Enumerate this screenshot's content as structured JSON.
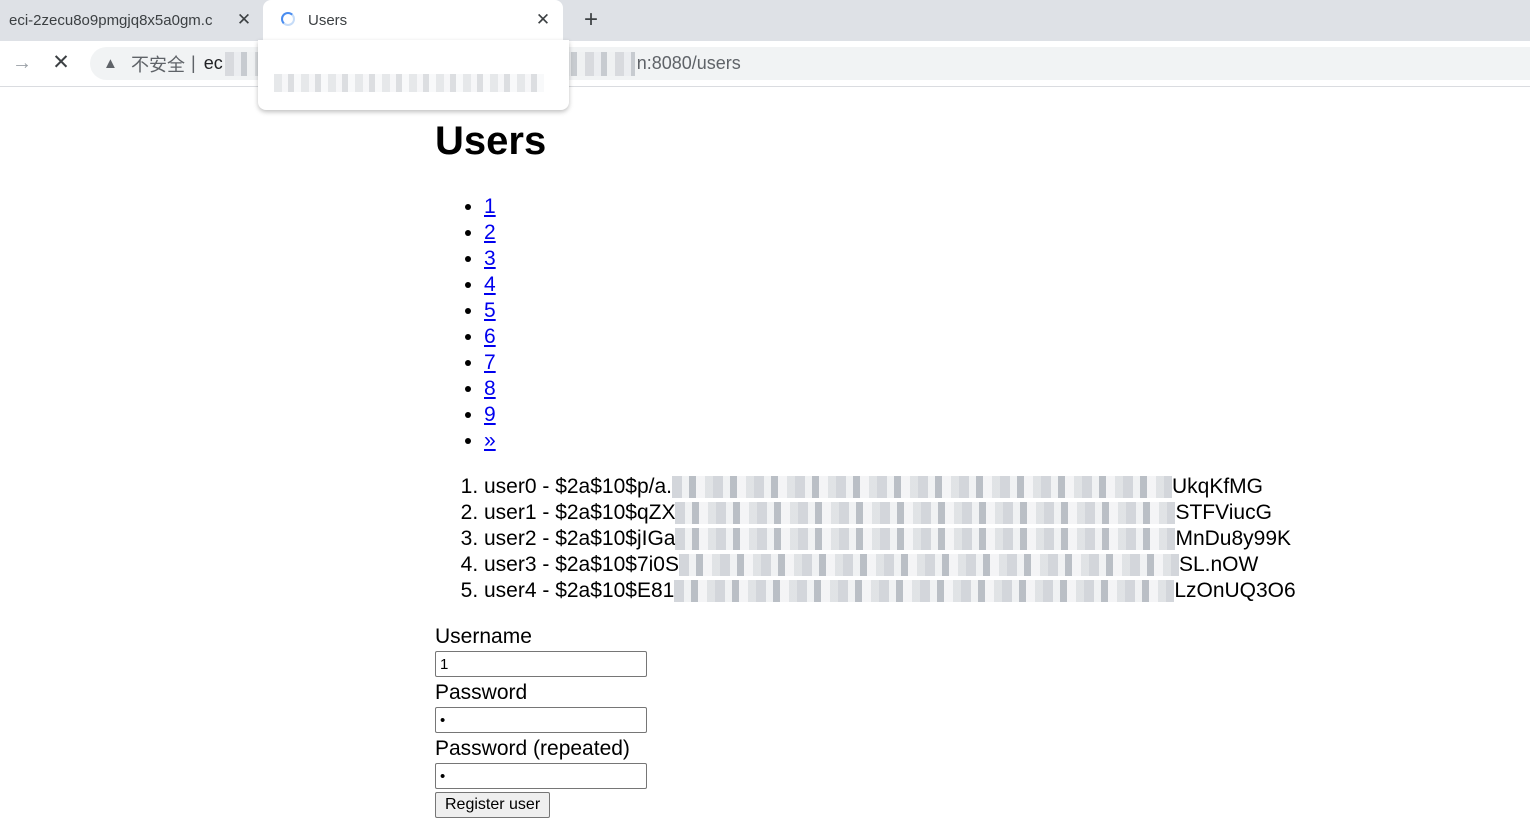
{
  "tabs": [
    {
      "title": "eci-2zecu8o9pmgjq8x5a0gm.c",
      "close_glyph": "✕"
    },
    {
      "title": "Users",
      "close_glyph": "✕"
    }
  ],
  "new_tab_glyph": "+",
  "toolbar": {
    "forward_glyph": "→",
    "stop_glyph": "✕",
    "warning_glyph": "▲",
    "insecure_label": "不安全",
    "separator": "|",
    "url_start": "ec",
    "url_end": "n:8080/users"
  },
  "page": {
    "title": "Users",
    "pagination": [
      "1",
      "2",
      "3",
      "4",
      "5",
      "6",
      "7",
      "8",
      "9",
      "»"
    ],
    "users": [
      {
        "text_start": "user0 - $2a$10$p/a.",
        "text_end": "UkqKfMG"
      },
      {
        "text_start": "user1 - $2a$10$qZX",
        "text_end": "STFViucG"
      },
      {
        "text_start": "user2 - $2a$10$jIGa",
        "text_end": "MnDu8y99K"
      },
      {
        "text_start": "user3 - $2a$10$7i0S",
        "text_end": "SL.nOW"
      },
      {
        "text_start": "user4 - $2a$10$E81",
        "text_end": "LzOnUQ3O6"
      }
    ],
    "form": {
      "username_label": "Username",
      "username_value": "1",
      "password_label": "Password",
      "password_value": "1",
      "password_repeat_label": "Password (repeated)",
      "password_repeat_value": "1",
      "submit_label": "Register user"
    }
  }
}
